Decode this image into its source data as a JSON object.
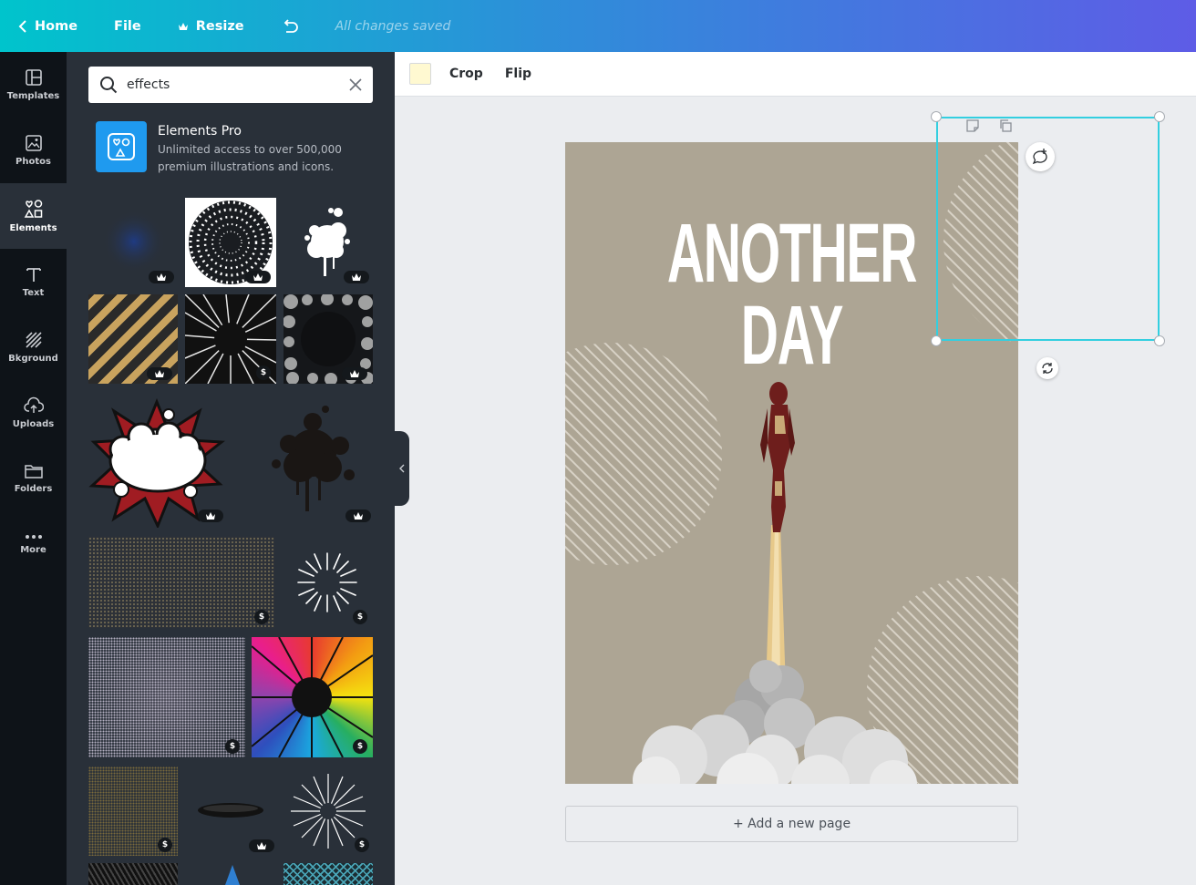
{
  "topbar": {
    "home": "Home",
    "file": "File",
    "resize": "Resize",
    "status": "All changes saved"
  },
  "rail": {
    "items": [
      {
        "label": "Templates",
        "icon": "templates-icon"
      },
      {
        "label": "Photos",
        "icon": "photos-icon"
      },
      {
        "label": "Elements",
        "icon": "elements-icon"
      },
      {
        "label": "Text",
        "icon": "text-icon"
      },
      {
        "label": "Bkground",
        "icon": "background-icon"
      },
      {
        "label": "Uploads",
        "icon": "uploads-icon"
      },
      {
        "label": "Folders",
        "icon": "folders-icon"
      },
      {
        "label": "More",
        "icon": "more-icon"
      }
    ],
    "active": "Elements"
  },
  "panel": {
    "search_value": "effects",
    "promo": {
      "title": "Elements Pro",
      "desc_line1": "Unlimited access to over 500,000",
      "desc_line2": "premium illustrations and icons."
    },
    "dollar": "$"
  },
  "toolbar": {
    "swatch_color": "#fff9d1",
    "crop": "Crop",
    "flip": "Flip"
  },
  "design": {
    "title_line1": "ANOTHER",
    "title_line2": "DAY",
    "background": "#ada594"
  },
  "add_page": "+ Add a new page",
  "colors": {
    "accent": "#33cfe0",
    "panel": "#293039",
    "rail": "#0e1318"
  }
}
